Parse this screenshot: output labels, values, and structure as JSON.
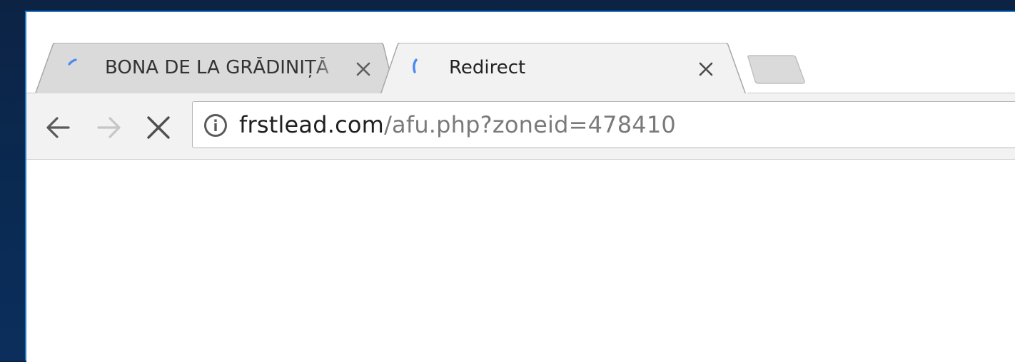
{
  "tabs": [
    {
      "title": "BONA DE LA GRĂDINIȚĂ",
      "state": "background",
      "loading": true,
      "close_icon": "close-icon"
    },
    {
      "title": "Redirect",
      "state": "active",
      "loading": true,
      "close_icon": "close-icon"
    }
  ],
  "new_tab": {
    "icon": "new-tab-icon"
  },
  "toolbar": {
    "back_icon": "arrow-left-icon",
    "forward_icon": "arrow-right-icon",
    "stop_icon": "close-icon"
  },
  "omnibox": {
    "security_icon": "info-icon",
    "host": "frstlead.com",
    "path": "/afu.php?zoneid=478410"
  },
  "colors": {
    "accent": "#4a8af4",
    "active_tab": "#f2f2f2",
    "inactive_tab": "#dadada",
    "frame_border": "#1d7fd0"
  }
}
